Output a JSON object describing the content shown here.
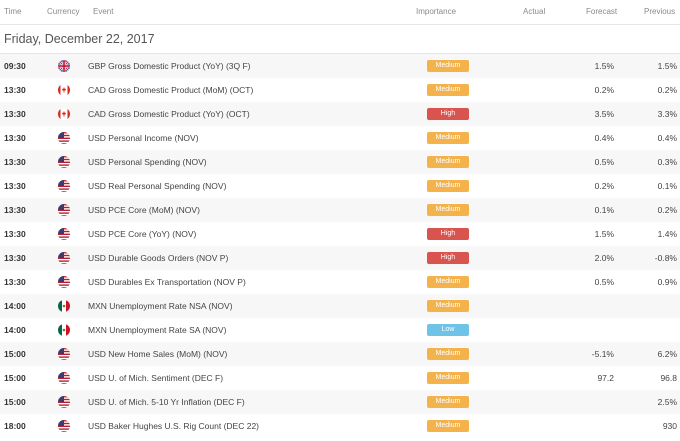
{
  "headers": {
    "time": "Time",
    "currency": "Currency",
    "event": "Event",
    "importance": "Importance",
    "actual": "Actual",
    "forecast": "Forecast",
    "previous": "Previous"
  },
  "date_label": "Friday, December 22, 2017",
  "colors": {
    "Medium": "#f4b24a",
    "High": "#d9534f",
    "Low": "#6fc3e6"
  },
  "rows": [
    {
      "time": "09:30",
      "flag": "gb-flag-icon",
      "event": "GBP Gross Domestic Product (YoY) (3Q F)",
      "importance": "Medium",
      "actual": "",
      "forecast": "1.5%",
      "previous": "1.5%"
    },
    {
      "time": "13:30",
      "flag": "ca-flag-icon",
      "event": "CAD Gross Domestic Product (MoM) (OCT)",
      "importance": "Medium",
      "actual": "",
      "forecast": "0.2%",
      "previous": "0.2%"
    },
    {
      "time": "13:30",
      "flag": "ca-flag-icon",
      "event": "CAD Gross Domestic Product (YoY) (OCT)",
      "importance": "High",
      "actual": "",
      "forecast": "3.5%",
      "previous": "3.3%"
    },
    {
      "time": "13:30",
      "flag": "us-flag-icon",
      "event": "USD Personal Income (NOV)",
      "importance": "Medium",
      "actual": "",
      "forecast": "0.4%",
      "previous": "0.4%"
    },
    {
      "time": "13:30",
      "flag": "us-flag-icon",
      "event": "USD Personal Spending (NOV)",
      "importance": "Medium",
      "actual": "",
      "forecast": "0.5%",
      "previous": "0.3%"
    },
    {
      "time": "13:30",
      "flag": "us-flag-icon",
      "event": "USD Real Personal Spending (NOV)",
      "importance": "Medium",
      "actual": "",
      "forecast": "0.2%",
      "previous": "0.1%"
    },
    {
      "time": "13:30",
      "flag": "us-flag-icon",
      "event": "USD PCE Core (MoM) (NOV)",
      "importance": "Medium",
      "actual": "",
      "forecast": "0.1%",
      "previous": "0.2%"
    },
    {
      "time": "13:30",
      "flag": "us-flag-icon",
      "event": "USD PCE Core (YoY) (NOV)",
      "importance": "High",
      "actual": "",
      "forecast": "1.5%",
      "previous": "1.4%"
    },
    {
      "time": "13:30",
      "flag": "us-flag-icon",
      "event": "USD Durable Goods Orders (NOV P)",
      "importance": "High",
      "actual": "",
      "forecast": "2.0%",
      "previous": "-0.8%"
    },
    {
      "time": "13:30",
      "flag": "us-flag-icon",
      "event": "USD Durables Ex Transportation (NOV P)",
      "importance": "Medium",
      "actual": "",
      "forecast": "0.5%",
      "previous": "0.9%"
    },
    {
      "time": "14:00",
      "flag": "mx-flag-icon",
      "event": "MXN Unemployment Rate NSA (NOV)",
      "importance": "Medium",
      "actual": "",
      "forecast": "",
      "previous": ""
    },
    {
      "time": "14:00",
      "flag": "mx-flag-icon",
      "event": "MXN Unemployment Rate SA (NOV)",
      "importance": "Low",
      "actual": "",
      "forecast": "",
      "previous": ""
    },
    {
      "time": "15:00",
      "flag": "us-flag-icon",
      "event": "USD New Home Sales (MoM) (NOV)",
      "importance": "Medium",
      "actual": "",
      "forecast": "-5.1%",
      "previous": "6.2%"
    },
    {
      "time": "15:00",
      "flag": "us-flag-icon",
      "event": "USD U. of Mich. Sentiment (DEC F)",
      "importance": "Medium",
      "actual": "",
      "forecast": "97.2",
      "previous": "96.8"
    },
    {
      "time": "15:00",
      "flag": "us-flag-icon",
      "event": "USD U. of Mich. 5-10 Yr Inflation (DEC F)",
      "importance": "Medium",
      "actual": "",
      "forecast": "",
      "previous": "2.5%"
    },
    {
      "time": "18:00",
      "flag": "us-flag-icon",
      "event": "USD Baker Hughes U.S. Rig Count (DEC 22)",
      "importance": "Medium",
      "actual": "",
      "forecast": "",
      "previous": "930"
    }
  ]
}
